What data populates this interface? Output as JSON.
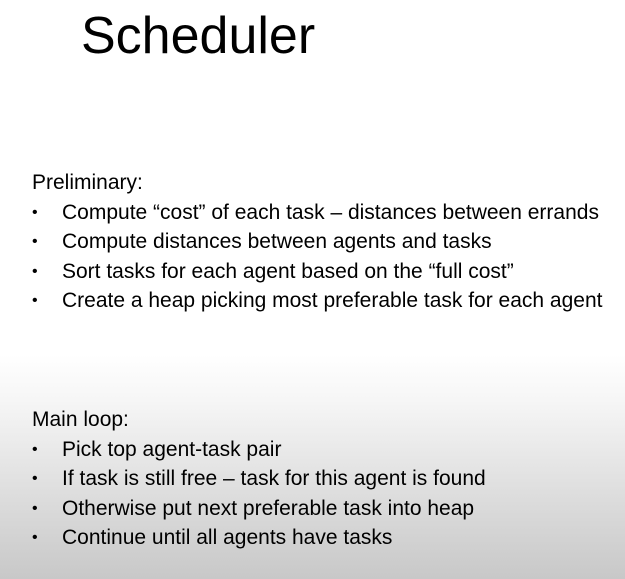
{
  "slide": {
    "title": "Scheduler"
  },
  "preliminary": {
    "heading": "Preliminary:",
    "bullet_glyph": "•",
    "items": [
      "Compute “cost” of each task – distances between errands",
      "Compute distances between agents and tasks",
      "Sort tasks for each agent based on the “full cost”",
      "Create a heap picking most preferable task for each agent"
    ]
  },
  "main_loop": {
    "heading": "Main loop:",
    "bullet_glyph": "•",
    "items": [
      "Pick top agent-task pair",
      "If task is still free – task for this agent is found",
      "Otherwise put next preferable task into heap",
      "Continue until all agents have tasks"
    ]
  }
}
